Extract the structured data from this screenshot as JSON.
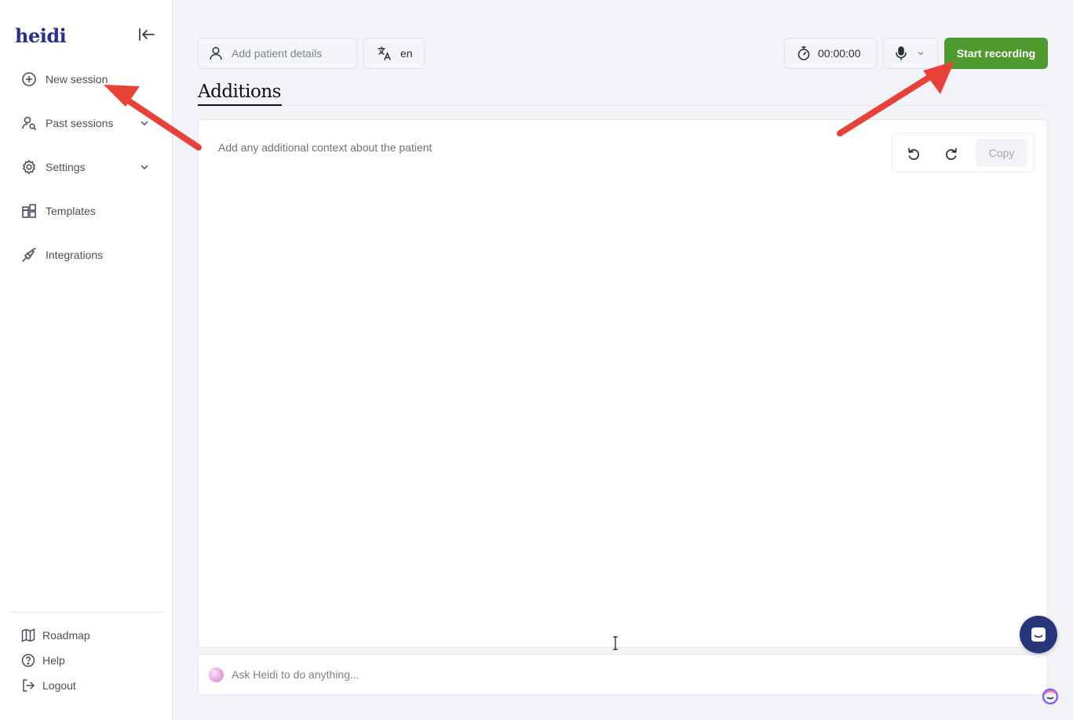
{
  "app": {
    "logo_text": "heidi",
    "brand_color": "#2a2f8f",
    "accent_color": "#4f9a2f"
  },
  "sidebar": {
    "collapse_icon": "collapse-left-icon",
    "items": [
      {
        "label": "New session",
        "icon": "plus-circle-icon"
      },
      {
        "label": "Past sessions",
        "icon": "user-search-icon",
        "has_chevron": true
      },
      {
        "label": "Settings",
        "icon": "gear-icon",
        "has_chevron": true
      },
      {
        "label": "Templates",
        "icon": "templates-icon"
      },
      {
        "label": "Integrations",
        "icon": "plug-icon"
      }
    ],
    "footer": [
      {
        "label": "Roadmap",
        "icon": "map-icon"
      },
      {
        "label": "Help",
        "icon": "help-circle-icon"
      },
      {
        "label": "Logout",
        "icon": "logout-icon"
      }
    ]
  },
  "toolbar": {
    "patient_placeholder": "Add patient details",
    "language": "en",
    "timer": "00:00:00",
    "record_label": "Start recording"
  },
  "tab": {
    "title": "Additions"
  },
  "editor": {
    "placeholder": "Add any additional context about the patient",
    "copy_label": "Copy"
  },
  "ask": {
    "placeholder": "Ask Heidi to do anything..."
  },
  "annotation": {
    "arrow_color": "#e8413a"
  }
}
